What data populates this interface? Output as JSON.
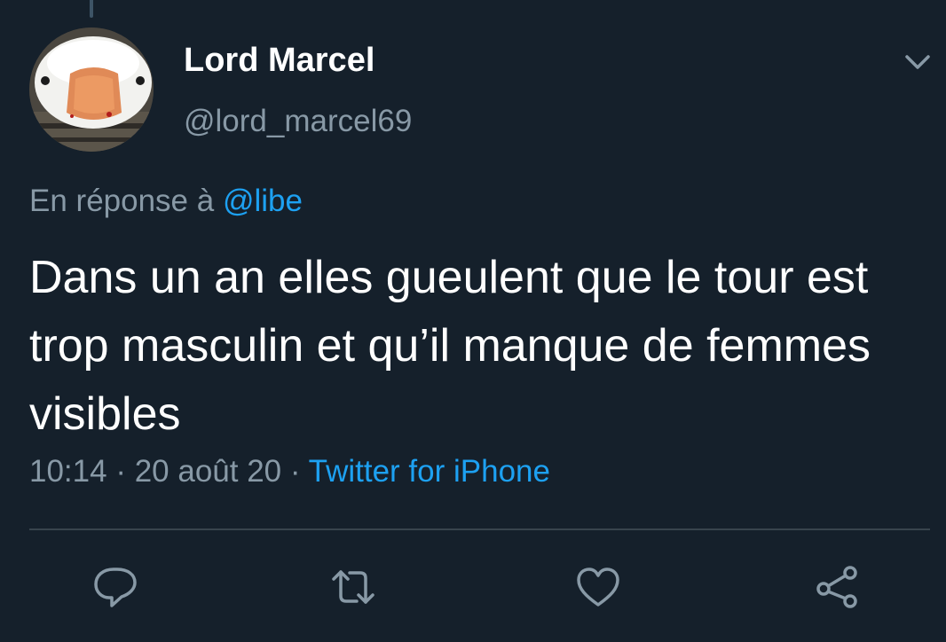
{
  "tweet": {
    "author": {
      "display_name": "Lord Marcel",
      "handle": "@lord_marcel69"
    },
    "reply_to": {
      "prefix": "En réponse à",
      "mention": "@libe"
    },
    "text": "Dans un an elles gueulent que le tour est trop masculin et qu’il manque de femmes visibles",
    "meta": {
      "time": "10:14",
      "separator": "·",
      "date": "20 août 20",
      "source": "Twitter for iPhone"
    }
  },
  "icons": {
    "menu": "chevron-down-icon",
    "reply": "reply-icon",
    "retweet": "retweet-icon",
    "like": "heart-icon",
    "share": "share-icon"
  },
  "colors": {
    "background": "#15202b",
    "accent": "#1da1f2",
    "secondary_text": "#8899a6",
    "divider": "#38444d"
  }
}
